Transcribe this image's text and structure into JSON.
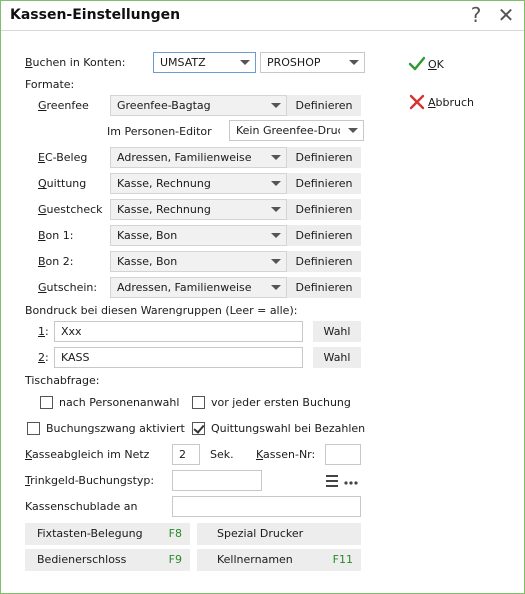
{
  "window": {
    "title": "Kassen-Einstellungen",
    "help_icon": "?",
    "close_icon": "✕"
  },
  "buchen": {
    "label_u": "B",
    "label_rest": "uchen in Konten:",
    "konto1": "UMSATZ",
    "konto2": "PROSHOP"
  },
  "formate": {
    "heading": "Formate:",
    "define_label": "Definieren",
    "rows": [
      {
        "u": "G",
        "rest": "reenfee",
        "value": "Greenfee-Bagtag"
      },
      {
        "u": "E",
        "rest": "C-Beleg",
        "value": "Adressen, Familienweise"
      },
      {
        "u": "Q",
        "rest": "uittung",
        "value": "Kasse, Rechnung"
      },
      {
        "u": "G",
        "rest": "uestcheck",
        "value": "Kasse, Rechnung"
      },
      {
        "u": "B",
        "rest": "on 1:",
        "value": "Kasse, Bon"
      },
      {
        "u": "B",
        "rest": "on 2:",
        "value": "Kasse, Bon"
      },
      {
        "u": "G",
        "rest": "utschein:",
        "value": "Adressen, Familienweise"
      }
    ],
    "personen_editor": {
      "label": "Im Personen-Editor",
      "value": "Kein Greenfee-Druck"
    }
  },
  "bondruck": {
    "heading": "Bondruck bei diesen Warengruppen (Leer = alle):",
    "wahl_label": "Wahl",
    "rows": [
      {
        "u": "1",
        "rest": ":",
        "value": "Xxx"
      },
      {
        "u": "2",
        "rest": ":",
        "value": "KASS"
      }
    ]
  },
  "tischabfrage": {
    "heading": "Tischabfrage:",
    "option1": "nach Personenanwahl",
    "option2": "vor jeder ersten Buchung",
    "option1_checked": false,
    "option2_checked": false
  },
  "buchungszwang": {
    "label": "Buchungszwang aktiviert",
    "checked": false
  },
  "quittungswahl": {
    "label": "Quittungswahl bei Bezahlen",
    "checked": true
  },
  "kasseabgleich": {
    "label_u": "K",
    "label_rest": "asseabgleich im Netz",
    "value": "2",
    "unit": "Sek.",
    "kassen_nr_u": "K",
    "kassen_nr_rest": "assen-Nr:",
    "kassen_nr_value": ""
  },
  "trinkgeld": {
    "label_u": "T",
    "label_rest": "rinkgeld-Buchungstyp:",
    "value": ""
  },
  "kassenschublade": {
    "label": "Kassenschublade an",
    "value": ""
  },
  "bottom_buttons": [
    {
      "label": "Fixtasten-Belegung",
      "key": "F8"
    },
    {
      "label": "Spezial Drucker",
      "key": ""
    },
    {
      "label": "Bedienerschloss",
      "key": "F9"
    },
    {
      "label": "Kellnernamen",
      "key": "F11"
    }
  ],
  "sidebar": {
    "ok_u": "O",
    "ok_rest": "K",
    "cancel_u": "A",
    "cancel_rest": "bbruch",
    "ok_color": "#2e9b2e",
    "cancel_color": "#d63333"
  }
}
